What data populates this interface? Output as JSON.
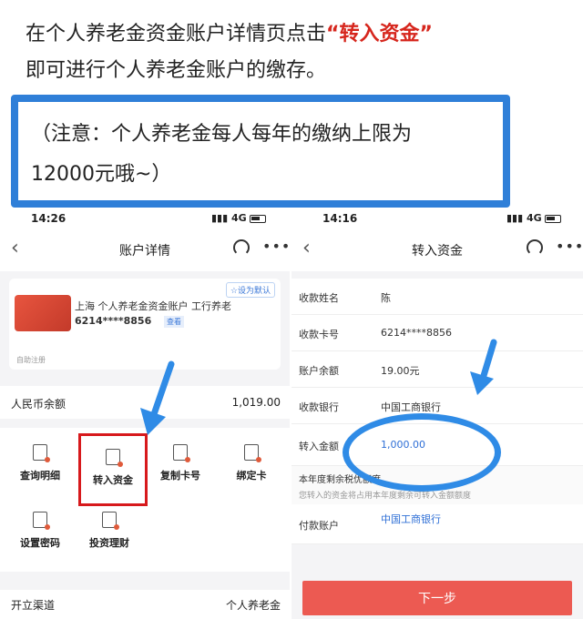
{
  "intro": {
    "line1_prefix": "在个人养老金资金账户详情页点击",
    "line1_highlight": "“转入资金”",
    "line2": "即可进行个人养老金账户的缴存。"
  },
  "note": {
    "line1": "（注意：个人养老金每人每年的缴纳上限为",
    "line2": "12000元哦~）"
  },
  "left_phone": {
    "time": "14:26",
    "signal": "4G",
    "title": "账户详情",
    "card": {
      "default_label": "☆设为默认",
      "account_name": "上海 个人养老金资金账户  工行养老",
      "account_no": "6214****8856",
      "view_label": "查看",
      "register_note": "自助注册"
    },
    "balance_label": "人民币余额",
    "balance_value": "1,019.00",
    "actions": [
      {
        "label": "查询明细",
        "icon": "detail-icon"
      },
      {
        "label": "转入资金",
        "icon": "transfer-in-icon"
      },
      {
        "label": "复制卡号",
        "icon": "copy-icon"
      },
      {
        "label": "绑定卡",
        "icon": "bind-card-icon"
      },
      {
        "label": "设置密码",
        "icon": "lock-icon"
      },
      {
        "label": "投资理财",
        "icon": "invest-icon"
      }
    ],
    "channel_label": "开立渠道",
    "channel_value": "个人养老金"
  },
  "right_phone": {
    "time": "14:16",
    "signal": "4G",
    "title": "转入资金",
    "fields": [
      {
        "label": "收款姓名",
        "value": "陈"
      },
      {
        "label": "收款卡号",
        "value": "6214****8856"
      },
      {
        "label": "账户余额",
        "value": "19.00元"
      },
      {
        "label": "收款银行",
        "value": "中国工商银行"
      },
      {
        "label": "转入金额",
        "value": "1,000.00"
      }
    ],
    "tip_title": "本年度剩余税优额度",
    "tip_sub": "您转入的资金将占用本年度剩余可转入金额额度",
    "payer_label": "付款账户",
    "payer_value": "中国工商银行",
    "next_label": "下一步"
  },
  "colors": {
    "accent_blue": "#2f7fd8",
    "highlight_red": "#d7191c",
    "button_red": "#ec5a52"
  }
}
